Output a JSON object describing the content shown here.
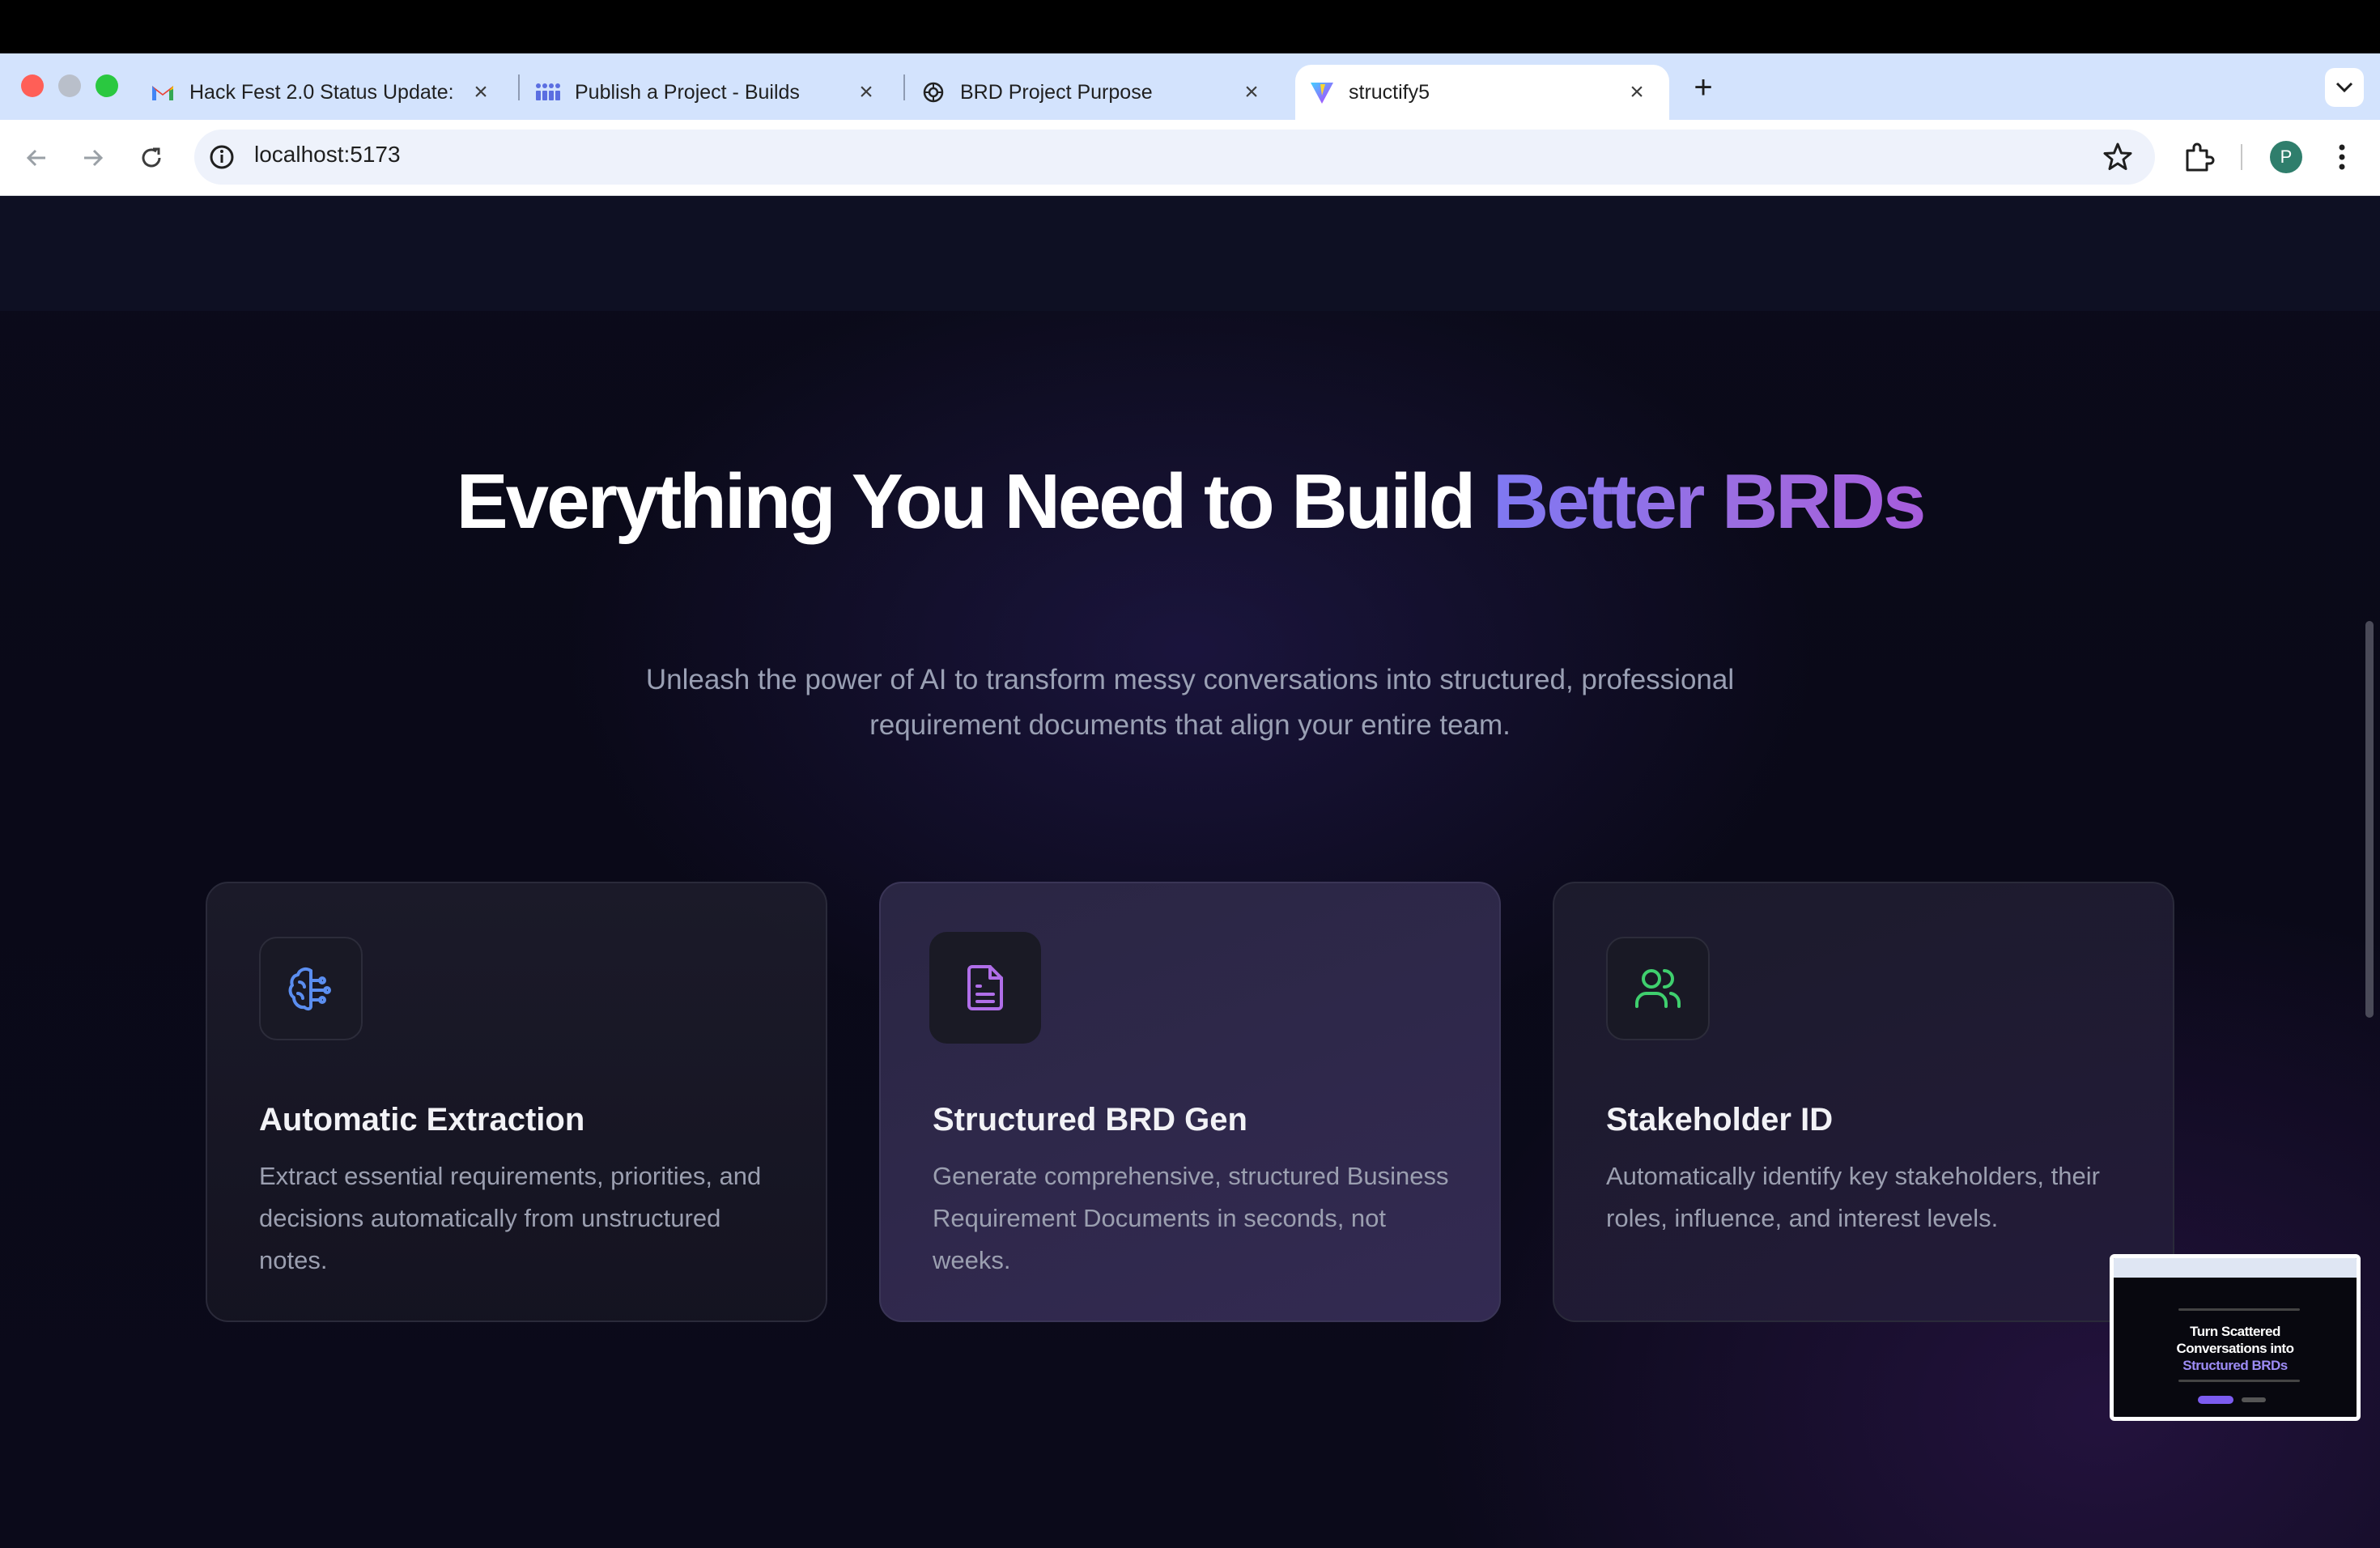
{
  "browser": {
    "tabs": [
      {
        "title": "Hack Fest 2.0 Status Update:",
        "icon": "gmail-icon"
      },
      {
        "title": "Publish a Project - Builds",
        "icon": "builds-icon"
      },
      {
        "title": "BRD Project Purpose",
        "icon": "openai-icon"
      },
      {
        "title": "structify5",
        "icon": "vite-icon",
        "active": true
      }
    ],
    "url": "localhost:5173",
    "profile_initial": "P"
  },
  "page": {
    "heading_main": "Everything You Need to Build ",
    "heading_accent": "Better BRDs",
    "subheading": "Unleash the power of AI to transform messy conversations into structured, professional requirement documents that align your entire team.",
    "features": [
      {
        "title": "Automatic Extraction",
        "description": "Extract essential requirements, priorities, and decisions automatically from unstructured notes.",
        "icon": "brain-icon",
        "color": "#5b8ef0"
      },
      {
        "title": "Structured BRD Gen",
        "description": "Generate comprehensive, structured Business Requirement Documents in seconds, not weeks.",
        "icon": "document-icon",
        "color": "#b06ee8"
      },
      {
        "title": "Stakeholder ID",
        "description": "Automatically identify key stakeholders, their roles, influence, and interest levels.",
        "icon": "users-icon",
        "color": "#3fcf6e"
      }
    ]
  },
  "pip": {
    "title_line1": "Turn Scattered",
    "title_line2": "Conversations into",
    "title_accent": "Structured BRDs"
  },
  "colors": {
    "accent_start": "#7f78f2",
    "accent_end": "#a65cdc",
    "background": "#0b0a1a"
  }
}
